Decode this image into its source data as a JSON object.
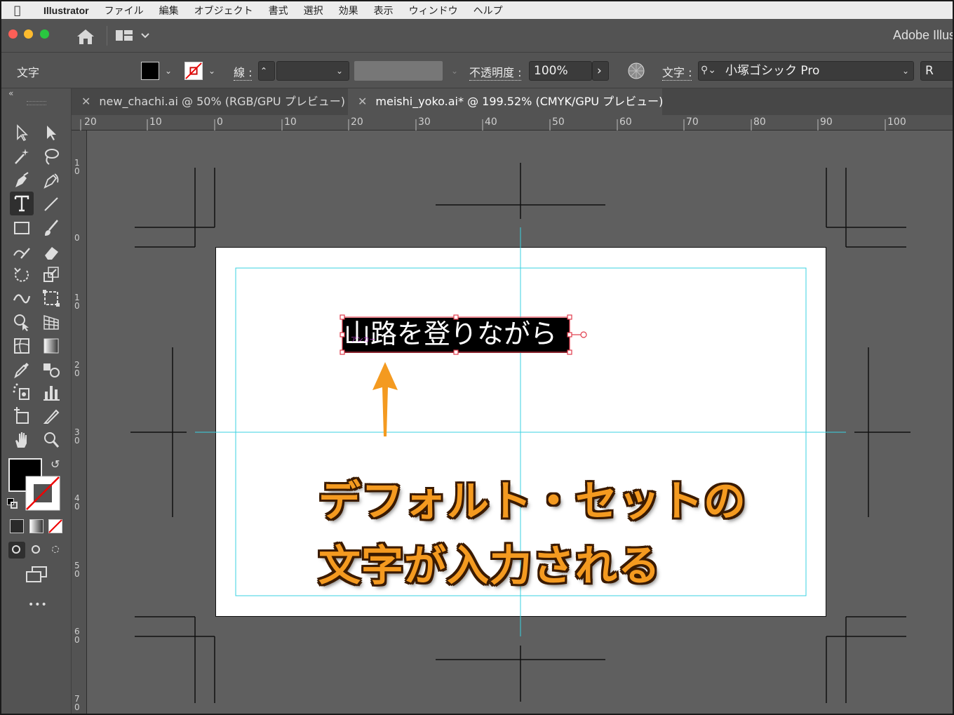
{
  "menubar": {
    "app_name": "Illustrator",
    "items": [
      "ファイル",
      "編集",
      "オブジェクト",
      "書式",
      "選択",
      "効果",
      "表示",
      "ウィンドウ",
      "ヘルプ"
    ]
  },
  "titlebar": {
    "brand": "Adobe Illus"
  },
  "control_bar": {
    "type_label": "文字",
    "stroke_label": "線 :",
    "opacity_label": "不透明度 :",
    "opacity_value": "100%",
    "font_label": "文字 :",
    "font_name": "小塚ゴシック Pro",
    "font_style": "R"
  },
  "tabs": [
    {
      "label": "new_chachi.ai @ 50% (RGB/GPU プレビュー)",
      "active": false
    },
    {
      "label": "meishi_yoko.ai* @ 199.52% (CMYK/GPU プレビュー)",
      "active": true
    }
  ],
  "rulers": {
    "h_ticks": [
      "20",
      "10",
      "0",
      "10",
      "20",
      "30",
      "40",
      "50",
      "60",
      "70",
      "80",
      "90",
      "100"
    ],
    "v_ticks": [
      "1 0",
      "0",
      "1 0",
      "2 0",
      "3 0",
      "4 0",
      "5 0",
      "6 0",
      "7 0"
    ]
  },
  "canvas": {
    "typed_text": "山路を登りながら",
    "annotation_line1": "デフォルト・セットの",
    "annotation_line2": "文字が入力される",
    "annotation_color": "#f49a20",
    "guide_color": "#39d2e0"
  },
  "toolbar": {
    "more_label": "•••"
  }
}
